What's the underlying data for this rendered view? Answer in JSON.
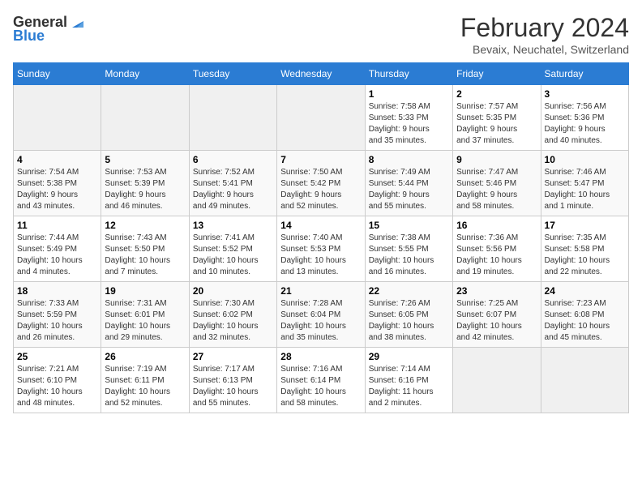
{
  "logo": {
    "general": "General",
    "blue": "Blue"
  },
  "title": "February 2024",
  "location": "Bevaix, Neuchatel, Switzerland",
  "days_of_week": [
    "Sunday",
    "Monday",
    "Tuesday",
    "Wednesday",
    "Thursday",
    "Friday",
    "Saturday"
  ],
  "weeks": [
    [
      {
        "day": "",
        "info": ""
      },
      {
        "day": "",
        "info": ""
      },
      {
        "day": "",
        "info": ""
      },
      {
        "day": "",
        "info": ""
      },
      {
        "day": "1",
        "info": "Sunrise: 7:58 AM\nSunset: 5:33 PM\nDaylight: 9 hours\nand 35 minutes."
      },
      {
        "day": "2",
        "info": "Sunrise: 7:57 AM\nSunset: 5:35 PM\nDaylight: 9 hours\nand 37 minutes."
      },
      {
        "day": "3",
        "info": "Sunrise: 7:56 AM\nSunset: 5:36 PM\nDaylight: 9 hours\nand 40 minutes."
      }
    ],
    [
      {
        "day": "4",
        "info": "Sunrise: 7:54 AM\nSunset: 5:38 PM\nDaylight: 9 hours\nand 43 minutes."
      },
      {
        "day": "5",
        "info": "Sunrise: 7:53 AM\nSunset: 5:39 PM\nDaylight: 9 hours\nand 46 minutes."
      },
      {
        "day": "6",
        "info": "Sunrise: 7:52 AM\nSunset: 5:41 PM\nDaylight: 9 hours\nand 49 minutes."
      },
      {
        "day": "7",
        "info": "Sunrise: 7:50 AM\nSunset: 5:42 PM\nDaylight: 9 hours\nand 52 minutes."
      },
      {
        "day": "8",
        "info": "Sunrise: 7:49 AM\nSunset: 5:44 PM\nDaylight: 9 hours\nand 55 minutes."
      },
      {
        "day": "9",
        "info": "Sunrise: 7:47 AM\nSunset: 5:46 PM\nDaylight: 9 hours\nand 58 minutes."
      },
      {
        "day": "10",
        "info": "Sunrise: 7:46 AM\nSunset: 5:47 PM\nDaylight: 10 hours\nand 1 minute."
      }
    ],
    [
      {
        "day": "11",
        "info": "Sunrise: 7:44 AM\nSunset: 5:49 PM\nDaylight: 10 hours\nand 4 minutes."
      },
      {
        "day": "12",
        "info": "Sunrise: 7:43 AM\nSunset: 5:50 PM\nDaylight: 10 hours\nand 7 minutes."
      },
      {
        "day": "13",
        "info": "Sunrise: 7:41 AM\nSunset: 5:52 PM\nDaylight: 10 hours\nand 10 minutes."
      },
      {
        "day": "14",
        "info": "Sunrise: 7:40 AM\nSunset: 5:53 PM\nDaylight: 10 hours\nand 13 minutes."
      },
      {
        "day": "15",
        "info": "Sunrise: 7:38 AM\nSunset: 5:55 PM\nDaylight: 10 hours\nand 16 minutes."
      },
      {
        "day": "16",
        "info": "Sunrise: 7:36 AM\nSunset: 5:56 PM\nDaylight: 10 hours\nand 19 minutes."
      },
      {
        "day": "17",
        "info": "Sunrise: 7:35 AM\nSunset: 5:58 PM\nDaylight: 10 hours\nand 22 minutes."
      }
    ],
    [
      {
        "day": "18",
        "info": "Sunrise: 7:33 AM\nSunset: 5:59 PM\nDaylight: 10 hours\nand 26 minutes."
      },
      {
        "day": "19",
        "info": "Sunrise: 7:31 AM\nSunset: 6:01 PM\nDaylight: 10 hours\nand 29 minutes."
      },
      {
        "day": "20",
        "info": "Sunrise: 7:30 AM\nSunset: 6:02 PM\nDaylight: 10 hours\nand 32 minutes."
      },
      {
        "day": "21",
        "info": "Sunrise: 7:28 AM\nSunset: 6:04 PM\nDaylight: 10 hours\nand 35 minutes."
      },
      {
        "day": "22",
        "info": "Sunrise: 7:26 AM\nSunset: 6:05 PM\nDaylight: 10 hours\nand 38 minutes."
      },
      {
        "day": "23",
        "info": "Sunrise: 7:25 AM\nSunset: 6:07 PM\nDaylight: 10 hours\nand 42 minutes."
      },
      {
        "day": "24",
        "info": "Sunrise: 7:23 AM\nSunset: 6:08 PM\nDaylight: 10 hours\nand 45 minutes."
      }
    ],
    [
      {
        "day": "25",
        "info": "Sunrise: 7:21 AM\nSunset: 6:10 PM\nDaylight: 10 hours\nand 48 minutes."
      },
      {
        "day": "26",
        "info": "Sunrise: 7:19 AM\nSunset: 6:11 PM\nDaylight: 10 hours\nand 52 minutes."
      },
      {
        "day": "27",
        "info": "Sunrise: 7:17 AM\nSunset: 6:13 PM\nDaylight: 10 hours\nand 55 minutes."
      },
      {
        "day": "28",
        "info": "Sunrise: 7:16 AM\nSunset: 6:14 PM\nDaylight: 10 hours\nand 58 minutes."
      },
      {
        "day": "29",
        "info": "Sunrise: 7:14 AM\nSunset: 6:16 PM\nDaylight: 11 hours\nand 2 minutes."
      },
      {
        "day": "",
        "info": ""
      },
      {
        "day": "",
        "info": ""
      }
    ]
  ]
}
